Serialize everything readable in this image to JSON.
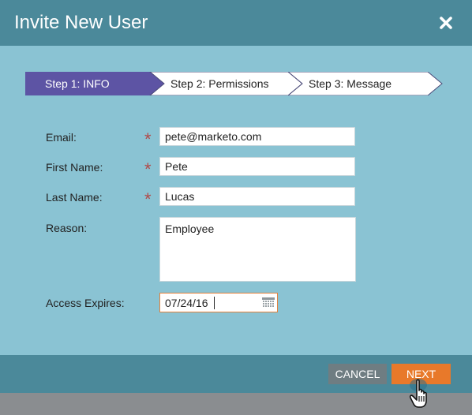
{
  "dialog": {
    "title": "Invite New User",
    "close_icon": "close-icon"
  },
  "wizard": {
    "steps": [
      {
        "label": "Step 1: INFO",
        "active": true
      },
      {
        "label": "Step 2: Permissions",
        "active": false
      },
      {
        "label": "Step 3: Message",
        "active": false
      }
    ]
  },
  "form": {
    "email": {
      "label": "Email:",
      "value": "pete@marketo.com",
      "required_mark": "*"
    },
    "first_name": {
      "label": "First Name:",
      "value": "Pete",
      "required_mark": "*"
    },
    "last_name": {
      "label": "Last Name:",
      "value": "Lucas",
      "required_mark": "*"
    },
    "reason": {
      "label": "Reason:",
      "value": "Employee"
    },
    "access_expires": {
      "label": "Access Expires:",
      "value": "07/24/16",
      "icon": "calendar-icon"
    }
  },
  "footer": {
    "cancel_label": "CANCEL",
    "next_label": "NEXT"
  },
  "colors": {
    "dialog_bg": "#8ac3d3",
    "titlebar_bg": "#4b899a",
    "active_step": "#5d54a4",
    "required": "#b04a49",
    "next_button": "#e8792a",
    "cancel_button": "#6f7d82"
  }
}
